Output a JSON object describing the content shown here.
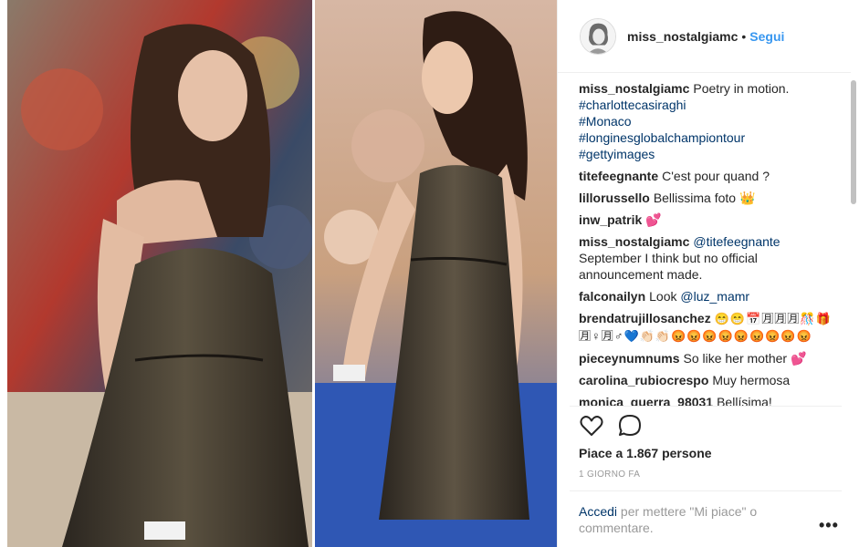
{
  "header": {
    "username": "miss_nostalgiamc",
    "separator": "•",
    "follow_label": "Segui"
  },
  "caption": {
    "username": "miss_nostalgiamc",
    "text": "Poetry in motion.",
    "hashtags": [
      "#charlottecasiraghi",
      "#Monaco",
      "#longinesglobalchampiontour",
      "#gettyimages"
    ]
  },
  "comments": [
    {
      "user": "titefeegnante",
      "text": "C'est pour quand ?"
    },
    {
      "user": "lillorussello",
      "text": "Bellissima foto 👑"
    },
    {
      "user": "inw_patrik",
      "text": "💕"
    },
    {
      "user": "miss_nostalgiamc",
      "mention": "@titefeegnante",
      "text": "September I think but no official announcement made."
    },
    {
      "user": "falconailyn",
      "text": "Look",
      "mention": "@luz_mamr"
    },
    {
      "user": "brendatrujillosanchez",
      "text": "😁😁📅🈷🈷🈷🎊🎁🈷♀🈷♂💙👏🏻👏🏻😡😡😡😡😡😡😡😡😡"
    },
    {
      "user": "pieceynumnums",
      "text": "So like her mother 💕"
    },
    {
      "user": "carolina_rubiocrespo",
      "text": "Muy hermosa"
    },
    {
      "user": "monica_guerra_98031",
      "text": "Bellísima!"
    }
  ],
  "actions": {
    "like_icon": "heart-icon",
    "comment_icon": "comment-icon"
  },
  "likes_text": "Piace a 1.867 persone",
  "timestamp": "1 GIORNO FA",
  "login": {
    "link_label": "Accedi",
    "rest": "per mettere \"Mi piace\" o commentare."
  },
  "more_label": "•••",
  "colors": {
    "accent": "#3897f0",
    "link": "#003569",
    "muted": "#999999",
    "text": "#262626"
  }
}
